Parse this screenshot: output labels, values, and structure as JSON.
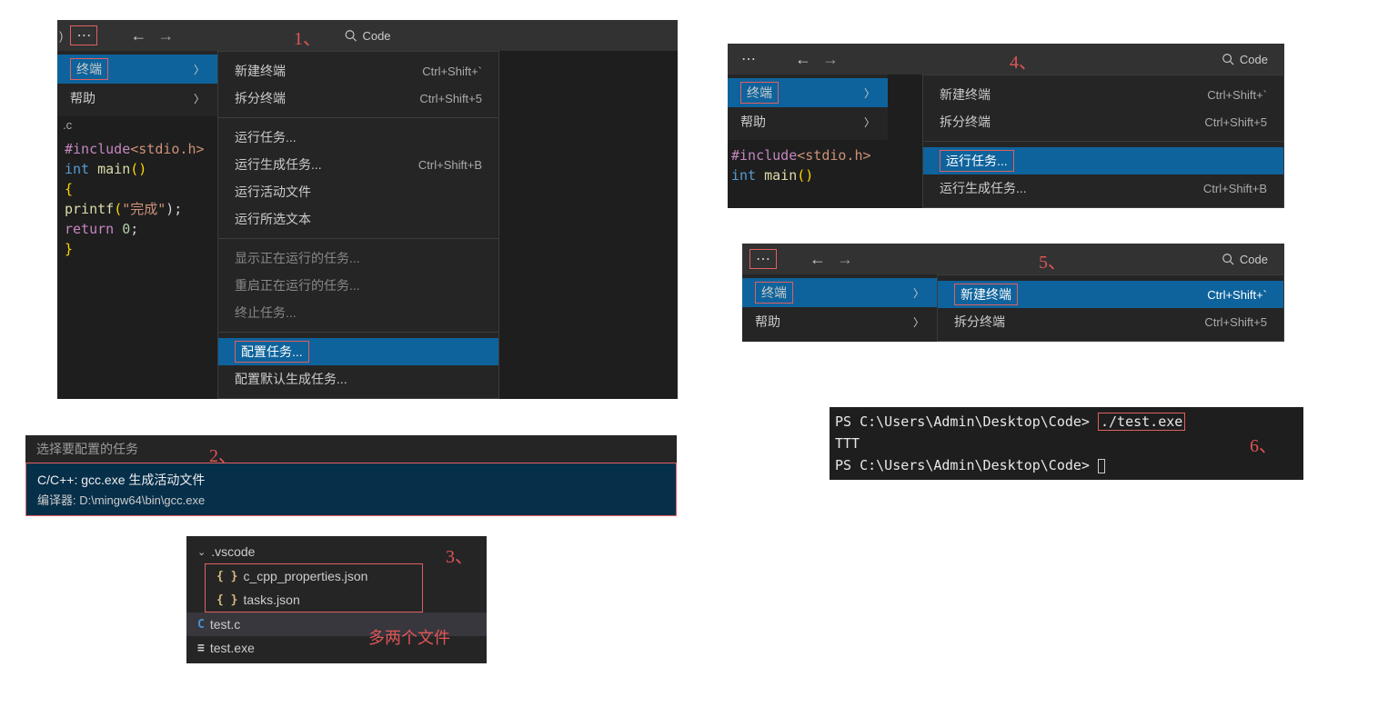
{
  "labels": {
    "step1": "1、",
    "step2": "2、",
    "step3": "3、",
    "step4": "4、",
    "step5": "5、",
    "step6": "6、"
  },
  "search_text": "Code",
  "titlebar_trail": ")",
  "menu_left": {
    "terminal": "终端",
    "help": "帮助"
  },
  "submenu1": [
    {
      "label": "新建终端",
      "shortcut": "Ctrl+Shift+`"
    },
    {
      "label": "拆分终端",
      "shortcut": "Ctrl+Shift+5"
    },
    {
      "sep": true
    },
    {
      "label": "运行任务..."
    },
    {
      "label": "运行生成任务...",
      "shortcut": "Ctrl+Shift+B"
    },
    {
      "label": "运行活动文件"
    },
    {
      "label": "运行所选文本"
    },
    {
      "sep": true
    },
    {
      "label": "显示正在运行的任务...",
      "muted": true
    },
    {
      "label": "重启正在运行的任务...",
      "muted": true
    },
    {
      "label": "终止任务...",
      "muted": true
    },
    {
      "sep": true
    },
    {
      "label": "配置任务...",
      "active": true,
      "hl": true
    },
    {
      "label": "配置默认生成任务..."
    }
  ],
  "code": {
    "l1a": "#include",
    "l1b": "<stdio.h>",
    "l2a": "int ",
    "l2b": "main",
    "l2c": "()",
    "l3": "{",
    "l4a": "    printf",
    "l4b": "(",
    "l4c": "\"完成\"",
    "l4d": ");",
    "l5a": "    return ",
    "l5b": "0",
    "l5c": ";",
    "l6": "}",
    "tab": ".c"
  },
  "picker": {
    "header": "选择要配置的任务",
    "title": "C/C++: gcc.exe 生成活动文件",
    "sub": "编译器: D:\\mingw64\\bin\\gcc.exe"
  },
  "tree": {
    "folder": ".vscode",
    "f1": "c_cpp_properties.json",
    "f2": "tasks.json",
    "f3": "test.c",
    "f4": "test.exe",
    "annot": "多两个文件"
  },
  "submenu4": [
    {
      "label": "新建终端",
      "shortcut": "Ctrl+Shift+`"
    },
    {
      "label": "拆分终端",
      "shortcut": "Ctrl+Shift+5"
    },
    {
      "sep": true
    },
    {
      "label": "运行任务...",
      "active": true,
      "hl": true
    },
    {
      "label": "运行生成任务...",
      "shortcut": "Ctrl+Shift+B"
    }
  ],
  "submenu5": [
    {
      "label": "新建终端",
      "shortcut": "Ctrl+Shift+`",
      "active": true,
      "hl": true
    },
    {
      "label": "拆分终端",
      "shortcut": "Ctrl+Shift+5"
    }
  ],
  "code4": {
    "l1a": "#include",
    "l1b": "<stdio.h>",
    "l2a": "int ",
    "l2b": "main",
    "l2c": "()"
  },
  "terminal": {
    "p1": "PS C:\\Users\\Admin\\Desktop\\Code> ",
    "cmd": "./test.exe",
    "out": "TTT",
    "p2": "PS C:\\Users\\Admin\\Desktop\\Code> "
  }
}
